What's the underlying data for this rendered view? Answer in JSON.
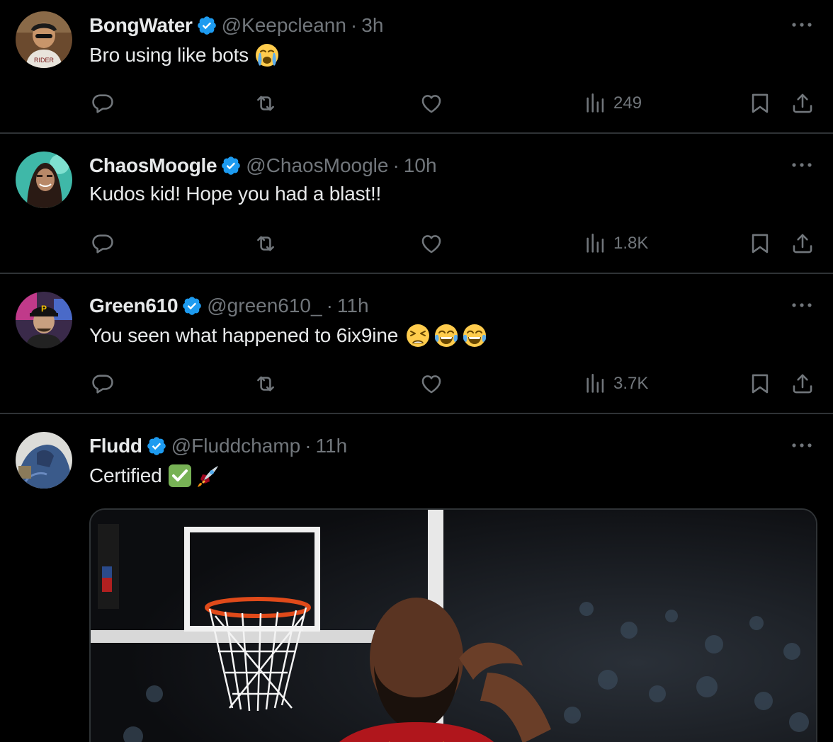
{
  "tweets": [
    {
      "name": "BongWater",
      "handle": "@Keepcleann",
      "dot": "·",
      "time": "3h",
      "text": "Bro using like bots",
      "emojis": [
        "loudly-crying-face"
      ],
      "views": "249"
    },
    {
      "name": "ChaosMoogle",
      "handle": "@ChaosMoogle",
      "dot": "·",
      "time": "10h",
      "text": "Kudos kid! Hope you had a blast!!",
      "emojis": [],
      "views": "1.8K"
    },
    {
      "name": "Green610",
      "handle": "@green610_",
      "dot": "·",
      "time": "11h",
      "text": "You seen what happened to 6ix9ine",
      "emojis": [
        "weary-face",
        "tears-of-joy-face",
        "tears-of-joy-face"
      ],
      "views": "3.7K"
    },
    {
      "name": "Fludd",
      "handle": "@Fluddchamp",
      "dot": "·",
      "time": "11h",
      "text": "Certified",
      "emojis": [
        "check-mark-button",
        "rocket"
      ],
      "media": "basketball-player-gif"
    }
  ],
  "icons": {
    "reply": "reply-icon",
    "retweet": "retweet-icon",
    "like": "heart-icon",
    "views": "views-icon",
    "bookmark": "bookmark-icon",
    "share": "share-icon",
    "more": "more-icon",
    "verified": "verified-badge-icon"
  },
  "colors": {
    "background": "#000000",
    "text_primary": "#e7e9ea",
    "text_secondary": "#71767b",
    "divider": "#2f3336",
    "verified_blue": "#1d9bf0"
  }
}
